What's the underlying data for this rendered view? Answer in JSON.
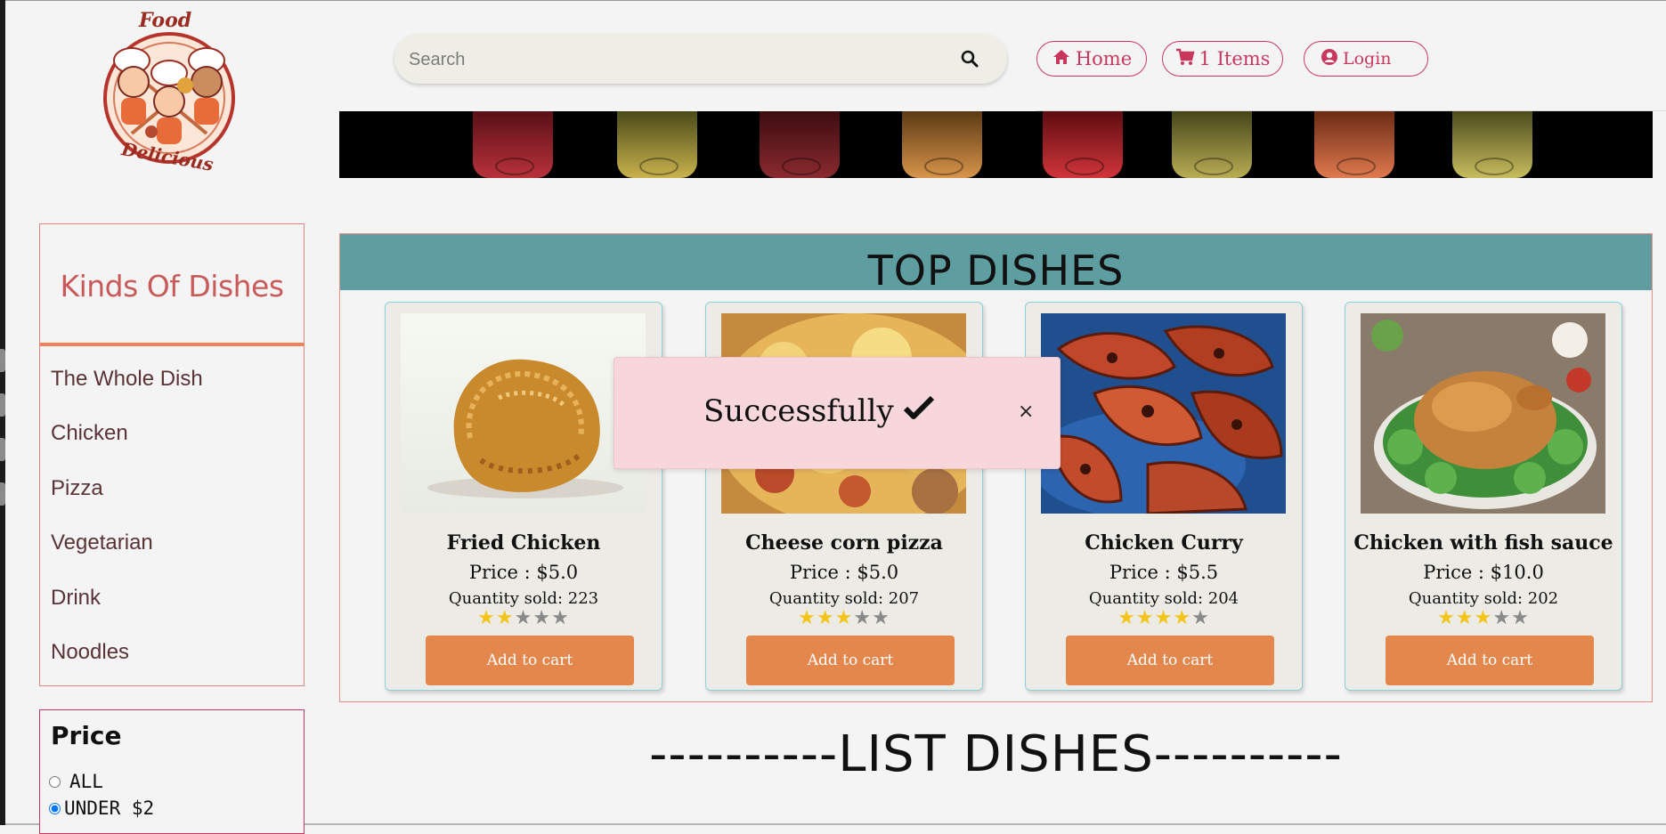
{
  "header": {
    "logo": {
      "top_text": "Food",
      "bottom_text": "Delicious"
    },
    "search": {
      "placeholder": "Search",
      "value": ""
    },
    "nav": {
      "home_label": "Home",
      "cart_label": "1 Items",
      "login_label": "Login"
    }
  },
  "sidebar": {
    "title": "Kinds Of Dishes",
    "items": [
      "The Whole Dish",
      "Chicken",
      "Pizza",
      "Vegetarian",
      "Drink",
      "Noodles"
    ]
  },
  "price_filter": {
    "title": "Price",
    "options": [
      {
        "label": "ALL",
        "checked": false
      },
      {
        "label": "UNDER $2",
        "checked": true
      }
    ]
  },
  "top_dishes": {
    "title": "TOP DISHES",
    "cards": [
      {
        "name": "Fried Chicken",
        "price": "Price : $5.0",
        "sold": "Quantity sold: 223",
        "rating": 2,
        "button": "Add to cart"
      },
      {
        "name": "Cheese corn pizza",
        "price": "Price : $5.0",
        "sold": "Quantity sold: 207",
        "rating": 3,
        "button": "Add to cart"
      },
      {
        "name": "Chicken Curry",
        "price": "Price : $5.5",
        "sold": "Quantity sold: 204",
        "rating": 4,
        "button": "Add to cart"
      },
      {
        "name": "Chicken with fish sauce",
        "price": "Price : $10.0",
        "sold": "Quantity sold: 202",
        "rating": 3,
        "button": "Add to cart"
      }
    ]
  },
  "toast": {
    "message": "Successfully",
    "close": "×"
  },
  "list_title": "----------LIST DISHES----------",
  "colors": {
    "accent": "#c8385e",
    "header_band": "#5f9ea0",
    "add_button": "#e3874c",
    "toast_bg": "#f7d7db",
    "star_on": "#f3c51b",
    "star_off": "#8a8a8a"
  }
}
